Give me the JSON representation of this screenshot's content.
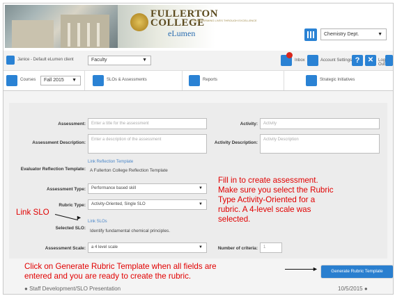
{
  "header": {
    "logo_line1": "FULLERTON",
    "logo_line2": "COLLEGE",
    "logo_tagline": "TRANSFORMING LIVES THROUGH EXCELLENCE",
    "logo_sub": "eLumen",
    "department_select": "Chemistry Dept."
  },
  "userbar": {
    "user_text": "Janice - Default eLumen client",
    "role_select": "Faculty",
    "inbox_label": "Inbox",
    "account_settings_label": "Account Settings",
    "help_label": "?",
    "logout_label": "Log Out"
  },
  "tabs": {
    "courses_label": "Courses",
    "term_select": "Fall 2015",
    "slos_label": "SLOs & Assessments",
    "reports_label": "Reports",
    "strategic_label": "Strategic Initiatives"
  },
  "form": {
    "assessment_label": "Assessment:",
    "assessment_placeholder": "Enter a title for the assessment",
    "activity_label": "Activity:",
    "activity_placeholder": "Activity",
    "description_label": "Assessment Description:",
    "description_placeholder": "Enter a description of the assessment",
    "activity_desc_label": "Activity Description:",
    "activity_desc_placeholder": "Activity Description",
    "evaluator_label": "Evaluator Reflection Template:",
    "link_reflection": "Link Reflection Template",
    "reflection_value": "A Fullerton College Reflection Template",
    "assessment_type_label": "Assessment Type:",
    "assessment_type_value": "Performance based skill",
    "rubric_type_label": "Rubric Type:",
    "rubric_type_value": "Activity-Oriented, Single SLO",
    "link_slos": "Link SLOs",
    "selected_slo_label": "Selected SLO:",
    "selected_slo_value": "Identify fundamental chemical principles.",
    "assessment_scale_label": "Assessment Scale:",
    "assessment_scale_value": "a 4 level scale",
    "num_criteria_label": "Number of criteria:",
    "num_criteria_value": "1"
  },
  "annotations": {
    "fill_in_line1": "Fill in to create assessment.",
    "fill_in_line2": "Make sure you select the Rubric",
    "fill_in_line3": "Type Activity-Oriented for a",
    "fill_in_line4": "rubric.  A 4-level scale was",
    "fill_in_line5": "selected.",
    "link_slo": "Link SLO",
    "generate_line1": "Click on Generate Rubric Template when all fields are",
    "generate_line2": "entered and you are ready to create the rubric."
  },
  "generate_button_label": "Generate Rubric Template",
  "footer": {
    "left": "Staff Development/SLO Presentation",
    "right": "10/5/2015"
  },
  "colors": {
    "accent_blue": "#2a82d4",
    "annotation_red": "#e10000",
    "inbox_badge_red": "#d9261c"
  }
}
